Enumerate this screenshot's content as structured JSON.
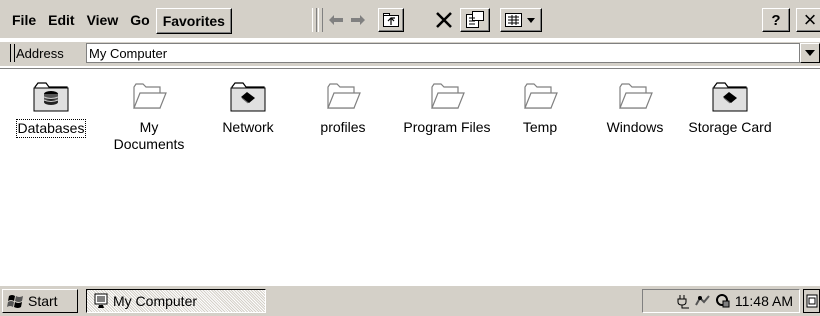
{
  "menu": {
    "file": "File",
    "edit": "Edit",
    "view": "View",
    "go": "Go",
    "favorites": "Favorites"
  },
  "toolbar": {
    "help_label": "?",
    "close_label": "×"
  },
  "address": {
    "label": "Address",
    "value": "My Computer"
  },
  "items": [
    {
      "label": "Databases",
      "icon": "databases-folder-icon"
    },
    {
      "label": "My",
      "label2": "Documents",
      "icon": "folder-icon"
    },
    {
      "label": "Network",
      "icon": "network-folder-icon"
    },
    {
      "label": "profiles",
      "icon": "folder-icon"
    },
    {
      "label": "Program Files",
      "icon": "folder-icon"
    },
    {
      "label": "Temp",
      "icon": "folder-icon"
    },
    {
      "label": "Windows",
      "icon": "folder-icon"
    },
    {
      "label": "Storage Card",
      "icon": "storage-card-folder-icon"
    }
  ],
  "taskbar": {
    "start_label": "Start",
    "task_label": "My Computer",
    "clock": "11:48 AM"
  }
}
